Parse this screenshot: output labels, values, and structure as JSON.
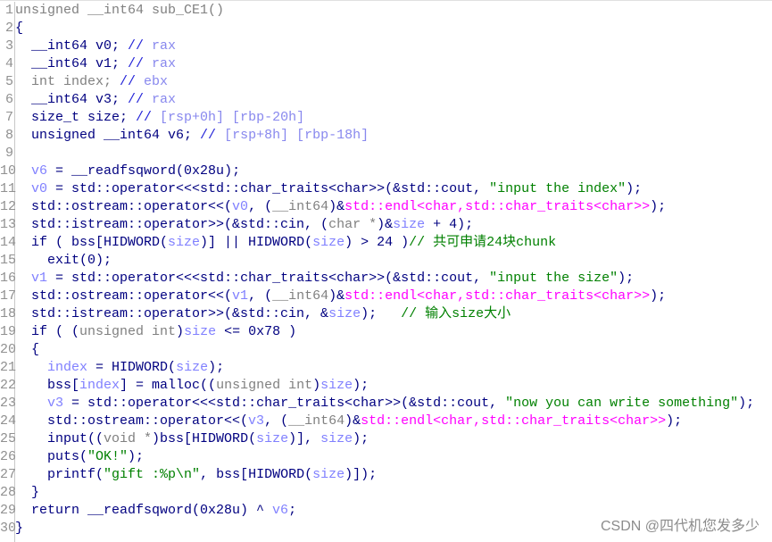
{
  "lines": [
    [
      [
        "t",
        "unsigned __int64 sub_CE1()"
      ]
    ],
    [
      [
        "k",
        "{"
      ]
    ],
    [
      [
        "k",
        "  __int64 v0; "
      ],
      [
        "cm",
        "// "
      ],
      [
        "r",
        "rax"
      ]
    ],
    [
      [
        "k",
        "  __int64 v1; "
      ],
      [
        "cm",
        "// "
      ],
      [
        "r",
        "rax"
      ]
    ],
    [
      [
        "t",
        "  int index; "
      ],
      [
        "cm",
        "// "
      ],
      [
        "r",
        "ebx"
      ]
    ],
    [
      [
        "k",
        "  __int64 v3; "
      ],
      [
        "cm",
        "// "
      ],
      [
        "r",
        "rax"
      ]
    ],
    [
      [
        "k",
        "  size_t size; "
      ],
      [
        "cm",
        "// "
      ],
      [
        "r",
        "[rsp+0h] [rbp-20h]"
      ]
    ],
    [
      [
        "k",
        "  unsigned __int64 v6; "
      ],
      [
        "cm",
        "// "
      ],
      [
        "r",
        "[rsp+8h] [rbp-18h]"
      ]
    ],
    [],
    [
      [
        "k",
        "  "
      ],
      [
        "v",
        "v6"
      ],
      [
        "k",
        " = __readfsqword(0x28u);"
      ]
    ],
    [
      [
        "k",
        "  "
      ],
      [
        "v",
        "v0"
      ],
      [
        "k",
        " = std::operator<<<std::char_traits<char>>(&std::cout, "
      ],
      [
        "s",
        "\"input the index\""
      ],
      [
        "k",
        ");"
      ]
    ],
    [
      [
        "k",
        "  std::ostream::operator<<("
      ],
      [
        "v",
        "v0"
      ],
      [
        "k",
        ", ("
      ],
      [
        "t",
        "__int64"
      ],
      [
        "k",
        ")&"
      ],
      [
        "m",
        "std::endl<char,std::char_traits<char>>"
      ],
      [
        "k",
        ");"
      ]
    ],
    [
      [
        "k",
        "  std::istream::operator>>(&std::cin, ("
      ],
      [
        "t",
        "char *"
      ],
      [
        "k",
        ")&"
      ],
      [
        "v",
        "size"
      ],
      [
        "k",
        " + 4);"
      ]
    ],
    [
      [
        "k",
        "  if ( bss[HIDWORD("
      ],
      [
        "v",
        "size"
      ],
      [
        "k",
        ")] || HIDWORD("
      ],
      [
        "v",
        "size"
      ],
      [
        "k",
        ") > 24 )"
      ],
      [
        "g",
        "// 共可申请24块chunk"
      ]
    ],
    [
      [
        "k",
        "    exit(0);"
      ]
    ],
    [
      [
        "k",
        "  "
      ],
      [
        "v",
        "v1"
      ],
      [
        "k",
        " = std::operator<<<std::char_traits<char>>(&std::cout, "
      ],
      [
        "s",
        "\"input the size\""
      ],
      [
        "k",
        ");"
      ]
    ],
    [
      [
        "k",
        "  std::ostream::operator<<("
      ],
      [
        "v",
        "v1"
      ],
      [
        "k",
        ", ("
      ],
      [
        "t",
        "__int64"
      ],
      [
        "k",
        ")&"
      ],
      [
        "m",
        "std::endl<char,std::char_traits<char>>"
      ],
      [
        "k",
        ");"
      ]
    ],
    [
      [
        "k",
        "  std::istream::operator>>(&std::cin, &"
      ],
      [
        "v",
        "size"
      ],
      [
        "k",
        ");   "
      ],
      [
        "g",
        "// 输入size大小"
      ]
    ],
    [
      [
        "k",
        "  if ( ("
      ],
      [
        "t",
        "unsigned int"
      ],
      [
        "k",
        ")"
      ],
      [
        "v",
        "size"
      ],
      [
        "k",
        " <= 0x78 )"
      ]
    ],
    [
      [
        "k",
        "  {"
      ]
    ],
    [
      [
        "k",
        "    "
      ],
      [
        "v",
        "index"
      ],
      [
        "k",
        " = HIDWORD("
      ],
      [
        "v",
        "size"
      ],
      [
        "k",
        ");"
      ]
    ],
    [
      [
        "k",
        "    bss["
      ],
      [
        "v",
        "index"
      ],
      [
        "k",
        "] = malloc(("
      ],
      [
        "t",
        "unsigned int"
      ],
      [
        "k",
        ")"
      ],
      [
        "v",
        "size"
      ],
      [
        "k",
        ");"
      ]
    ],
    [
      [
        "k",
        "    "
      ],
      [
        "v",
        "v3"
      ],
      [
        "k",
        " = std::operator<<<std::char_traits<char>>(&std::cout, "
      ],
      [
        "s",
        "\"now you can write something\""
      ],
      [
        "k",
        ");"
      ]
    ],
    [
      [
        "k",
        "    std::ostream::operator<<("
      ],
      [
        "v",
        "v3"
      ],
      [
        "k",
        ", ("
      ],
      [
        "t",
        "__int64"
      ],
      [
        "k",
        ")&"
      ],
      [
        "m",
        "std::endl<char,std::char_traits<char>>"
      ],
      [
        "k",
        ");"
      ]
    ],
    [
      [
        "k",
        "    input(("
      ],
      [
        "t",
        "void *"
      ],
      [
        "k",
        ")bss[HIDWORD("
      ],
      [
        "v",
        "size"
      ],
      [
        "k",
        ")], "
      ],
      [
        "v",
        "size"
      ],
      [
        "k",
        ");"
      ]
    ],
    [
      [
        "k",
        "    puts("
      ],
      [
        "s",
        "\"OK!\""
      ],
      [
        "k",
        ");"
      ]
    ],
    [
      [
        "k",
        "    printf("
      ],
      [
        "s",
        "\"gift :%p\\n\""
      ],
      [
        "k",
        ", bss[HIDWORD("
      ],
      [
        "v",
        "size"
      ],
      [
        "k",
        ")]);"
      ]
    ],
    [
      [
        "k",
        "  }"
      ]
    ],
    [
      [
        "k",
        "  return __readfsqword(0x28u) ^ "
      ],
      [
        "v",
        "v6"
      ],
      [
        "k",
        ";"
      ]
    ],
    [
      [
        "k",
        "}"
      ]
    ]
  ],
  "watermark": "CSDN @四代机您发多少",
  "colors": {
    "code": "#000080",
    "variable": "#8080ff",
    "type": "#808080",
    "library": "#ff00ff",
    "string": "#008000",
    "comment": "#008000"
  }
}
